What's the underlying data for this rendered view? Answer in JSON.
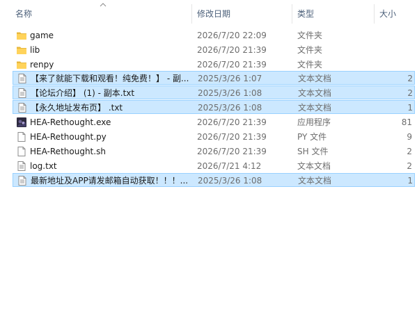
{
  "columns": {
    "name": "名称",
    "date": "修改日期",
    "type": "类型",
    "size": "大小"
  },
  "rows": [
    {
      "icon": "folder-icon",
      "name": "game",
      "date": "2026/7/20 22:09",
      "type": "文件夹",
      "size": "",
      "selected": false
    },
    {
      "icon": "folder-icon",
      "name": "lib",
      "date": "2026/7/20 21:39",
      "type": "文件夹",
      "size": "",
      "selected": false
    },
    {
      "icon": "folder-icon",
      "name": "renpy",
      "date": "2026/7/20 21:39",
      "type": "文件夹",
      "size": "",
      "selected": false
    },
    {
      "icon": "text-file-icon",
      "name": "【来了就能下载和观看！纯免费！】 - 副...",
      "date": "2025/3/26 1:07",
      "type": "文本文档",
      "size": "2",
      "selected": true
    },
    {
      "icon": "text-file-icon",
      "name": "【论坛介绍】 (1) - 副本.txt",
      "date": "2025/3/26 1:08",
      "type": "文本文档",
      "size": "2",
      "selected": true
    },
    {
      "icon": "text-file-icon",
      "name": "【永久地址发布页】 .txt",
      "date": "2025/3/26 1:08",
      "type": "文本文档",
      "size": "1",
      "selected": true
    },
    {
      "icon": "exe-app-icon",
      "name": "HEA-Rethought.exe",
      "date": "2026/7/20 21:39",
      "type": "应用程序",
      "size": "81",
      "selected": false
    },
    {
      "icon": "blank-file-icon",
      "name": "HEA-Rethought.py",
      "date": "2026/7/20 21:39",
      "type": "PY 文件",
      "size": "9",
      "selected": false
    },
    {
      "icon": "blank-file-icon",
      "name": "HEA-Rethought.sh",
      "date": "2026/7/20 21:39",
      "type": "SH 文件",
      "size": "2",
      "selected": false
    },
    {
      "icon": "text-file-icon",
      "name": "log.txt",
      "date": "2026/7/21 4:12",
      "type": "文本文档",
      "size": "2",
      "selected": false
    },
    {
      "icon": "text-file-icon",
      "name": "最新地址及APP请发邮箱自动获取！！！...",
      "date": "2025/3/26 1:08",
      "type": "文本文档",
      "size": "1",
      "selected": true
    }
  ]
}
